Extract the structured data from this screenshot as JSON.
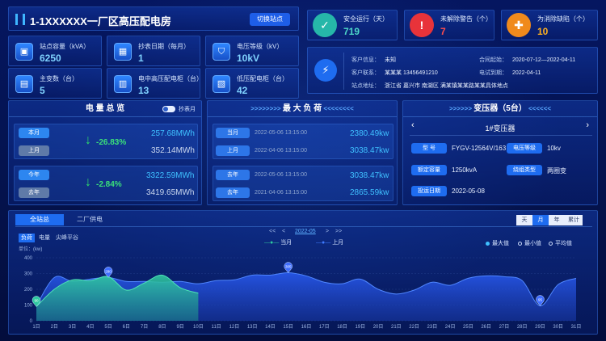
{
  "header": {
    "title": "1-1XXXXXX一厂区高压配电房",
    "switch_label": "切换站点"
  },
  "kpis": [
    {
      "label": "站点容量（kVA）",
      "value": "6250",
      "icon": "capacity-icon"
    },
    {
      "label": "抄表日期（每月）",
      "value": "1",
      "icon": "calendar-icon"
    },
    {
      "label": "电压等级（kV）",
      "value": "10kV",
      "icon": "voltage-icon"
    },
    {
      "label": "主变数（台）",
      "value": "5",
      "icon": "transformer-icon"
    },
    {
      "label": "电中高压配电柜（台）",
      "value": "13",
      "icon": "hv-cabinet-icon"
    },
    {
      "label": "低压配电柜（台）",
      "value": "42",
      "icon": "lv-cabinet-icon"
    }
  ],
  "stats": [
    {
      "label": "安全运行（天）",
      "value": "719",
      "color": "#4dd7c8",
      "icon": "shield-icon"
    },
    {
      "label": "未解除警告（个）",
      "value": "7",
      "color": "#ff4d4d",
      "icon": "warning-icon"
    },
    {
      "label": "为消除缺陷（个）",
      "value": "10",
      "color": "#ffb020",
      "icon": "puzzle-icon"
    }
  ],
  "customer": {
    "info_label": "客户信息：",
    "info_value": "未知",
    "contact_label": "客户联系：",
    "contact_value": "某某某  13456491210",
    "address_label": "站点地址：",
    "address_value": "浙江省 嘉兴市 南湖区 满某镇某某路某某具体地点",
    "contract_label": "合同起始：",
    "contract_value": "2020-07-12—2022-04-11",
    "expire_label": "电试到期：",
    "expire_value": "2022-04-11"
  },
  "energy": {
    "title": "电 量 总 览",
    "toggle_label": "抄表月",
    "rows": [
      {
        "cur_label": "本月",
        "prev_label": "上月",
        "cur_value": "257.68MWh",
        "prev_value": "352.14MWh",
        "pct": "-26.83%"
      },
      {
        "cur_label": "今年",
        "prev_label": "去年",
        "cur_value": "3322.59MWh",
        "prev_value": "3419.65MWh",
        "pct": "-2.84%"
      }
    ]
  },
  "maxload": {
    "title": "最 大 负 荷",
    "rows": [
      {
        "cur_label": "当月",
        "prev_label": "上月",
        "cur_date": "2022-05-06 13:15:00",
        "prev_date": "2022-04-06 13:15:00",
        "cur_value": "2380.49kw",
        "prev_value": "3038.47kw"
      },
      {
        "cur_label": "去年",
        "prev_label": "去年",
        "cur_date": "2022-05-06 13:15:00",
        "prev_date": "2021-04-06 13:15:00",
        "cur_value": "3038.47kw",
        "prev_value": "2865.59kw"
      }
    ]
  },
  "transformer": {
    "title": "变压器（5台）",
    "name": "1#变压器",
    "model_label": "型  号",
    "model_value": "FYGV-12564V/163",
    "voltage_label": "电压等级",
    "voltage_value": "10kv",
    "capacity_label": "额定容量",
    "capacity_value": "1250kvA",
    "winding_label": "绕组类型",
    "winding_value": "两圈变",
    "date_label": "投运日期",
    "date_value": "2022-05-08"
  },
  "chart_panel": {
    "tabs": [
      "全站总",
      "二厂供电"
    ],
    "subtabs": [
      "负荷",
      "电量",
      "尖峰平谷"
    ],
    "periods": [
      "天",
      "月",
      "年",
      "累计"
    ],
    "month_nav": "2022-05",
    "nav_prev2": "<<",
    "nav_prev": "<",
    "nav_next": ">",
    "nav_next2": ">>",
    "legend_cur": "当月",
    "legend_prev": "上月",
    "legend_max": "最大值",
    "legend_min": "最小值",
    "legend_avg": "平均值",
    "unit": "单位：(kw)"
  },
  "chart_data": {
    "type": "area",
    "x": [
      "1日",
      "2日",
      "3日",
      "4日",
      "5日",
      "6日",
      "7日",
      "8日",
      "9日",
      "10日",
      "11日",
      "12日",
      "13日",
      "14日",
      "15日",
      "16日",
      "17日",
      "18日",
      "19日",
      "20日",
      "21日",
      "22日",
      "23日",
      "24日",
      "25日",
      "26日",
      "27日",
      "28日",
      "29日",
      "30日",
      "31日"
    ],
    "ylim": [
      0,
      400
    ],
    "yticks": [
      0,
      100,
      200,
      300,
      400
    ],
    "series": [
      {
        "name": "当月",
        "color": "#2fc9a0",
        "values": [
          90,
          200,
          260,
          255,
          280,
          195,
          240,
          290,
          210,
          175
        ]
      },
      {
        "name": "上月",
        "color": "#2a5cf5",
        "values": [
          95,
          275,
          250,
          265,
          275,
          250,
          250,
          245,
          250,
          235,
          255,
          260,
          290,
          290,
          305,
          285,
          245,
          235,
          265,
          200,
          170,
          195,
          245,
          225,
          270,
          285,
          280,
          255,
          95,
          230,
          270
        ]
      }
    ],
    "markers": [
      {
        "series": "当月",
        "index": 0,
        "label": "90"
      },
      {
        "series": "上月",
        "index": 4,
        "label": "280"
      },
      {
        "series": "上月",
        "index": 14,
        "label": "305"
      },
      {
        "series": "上月",
        "index": 28,
        "label": "95"
      }
    ]
  }
}
